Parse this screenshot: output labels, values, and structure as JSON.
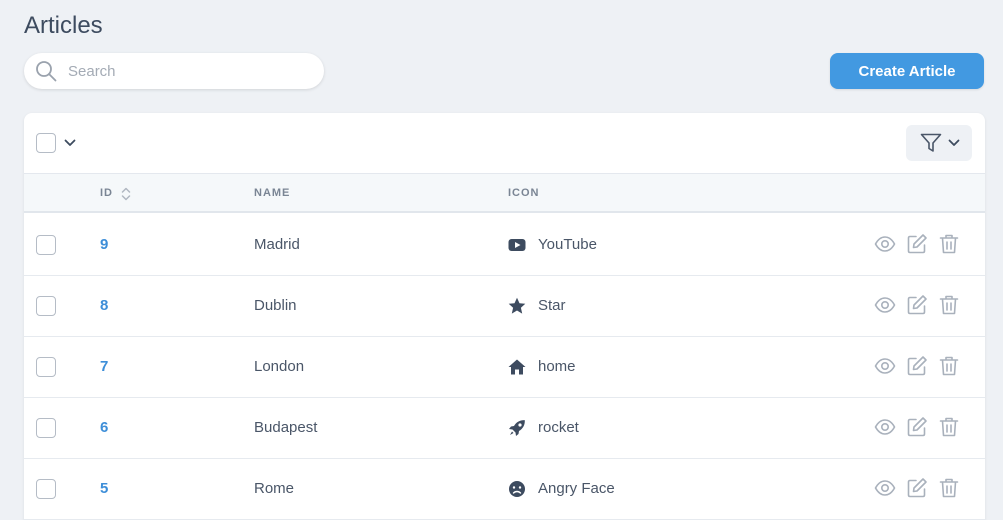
{
  "page": {
    "title": "Articles"
  },
  "search": {
    "placeholder": "Search",
    "icon": "search-icon"
  },
  "toolbar": {
    "create_label": "Create Article",
    "filter_icon": "filter-icon"
  },
  "table": {
    "columns": {
      "id": "ID",
      "name": "NAME",
      "icon": "ICON"
    },
    "rows": [
      {
        "id": "9",
        "name": "Madrid",
        "icon_label": "YouTube",
        "icon_glyph": "youtube-icon"
      },
      {
        "id": "8",
        "name": "Dublin",
        "icon_label": "Star",
        "icon_glyph": "star-icon"
      },
      {
        "id": "7",
        "name": "London",
        "icon_label": "home",
        "icon_glyph": "home-icon"
      },
      {
        "id": "6",
        "name": "Budapest",
        "icon_label": "rocket",
        "icon_glyph": "rocket-icon"
      },
      {
        "id": "5",
        "name": "Rome",
        "icon_label": "Angry Face",
        "icon_glyph": "angry-face-icon"
      }
    ]
  },
  "colors": {
    "accent": "#4299e1",
    "id_link": "#3d8ed8",
    "background": "#eef1f5",
    "icon_dark": "#3d4b5f",
    "action_gray": "#a9b1bc"
  }
}
